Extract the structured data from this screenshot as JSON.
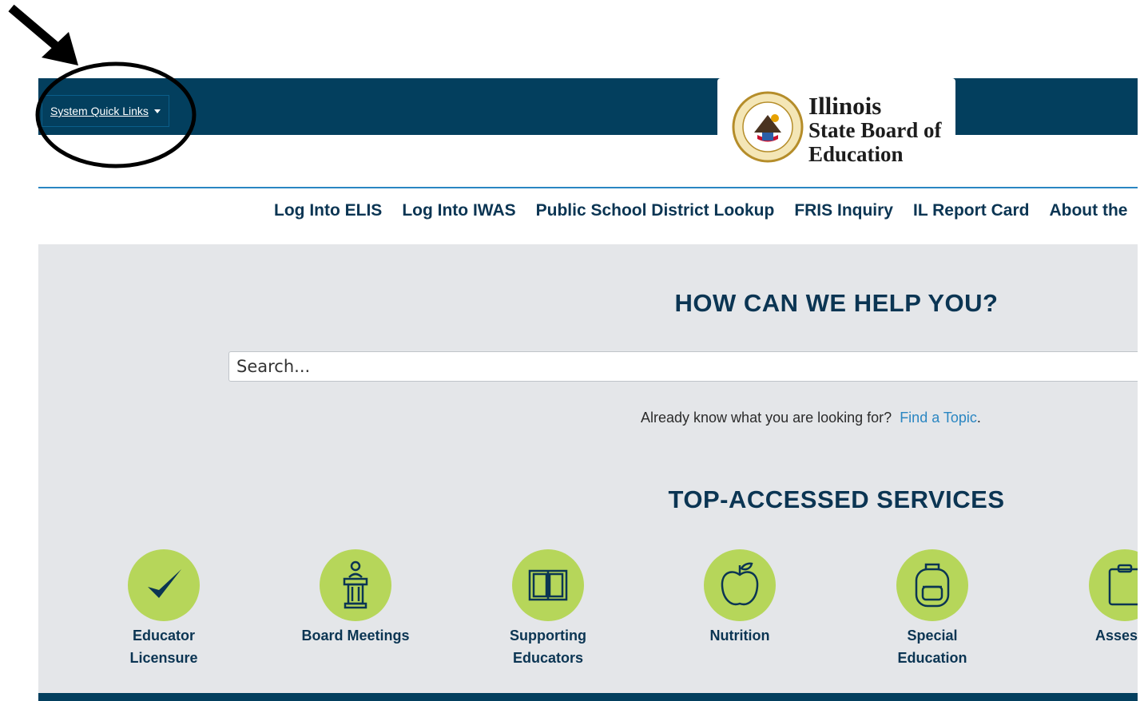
{
  "header": {
    "quick_links_label": "System Quick Links",
    "logo": {
      "line1": "Illinois",
      "line2": "State Board of",
      "line3": "Education"
    }
  },
  "nav": {
    "items": [
      {
        "label": "Log Into ELIS"
      },
      {
        "label": "Log Into IWAS"
      },
      {
        "label": "Public School District Lookup"
      },
      {
        "label": "FRIS Inquiry"
      },
      {
        "label": "IL Report Card"
      },
      {
        "label": "About the"
      }
    ]
  },
  "hero": {
    "title": "HOW CAN WE HELP YOU?",
    "search_placeholder": "Search...",
    "already_text": "Already know what you are looking for?",
    "find_topic_link": "Find a Topic",
    "find_topic_suffix": ".",
    "services_title": "TOP-ACCESSED SERVICES"
  },
  "services": [
    {
      "line1": "Educator",
      "line2": "Licensure",
      "icon": "checkmark-icon"
    },
    {
      "line1": "Board Meetings",
      "line2": "",
      "icon": "podium-icon"
    },
    {
      "line1": "Supporting",
      "line2": "Educators",
      "icon": "book-icon"
    },
    {
      "line1": "Nutrition",
      "line2": "",
      "icon": "apple-icon"
    },
    {
      "line1": "Special",
      "line2": "Education",
      "icon": "backpack-icon"
    },
    {
      "line1": "Assessn",
      "line2": "",
      "icon": "clipboard-icon"
    }
  ],
  "colors": {
    "header_navy": "#033f5e",
    "accent_green": "#b6d65a",
    "text_navy": "#0b3553",
    "link_blue": "#2a86c2",
    "hero_gray": "#e4e6e9"
  }
}
